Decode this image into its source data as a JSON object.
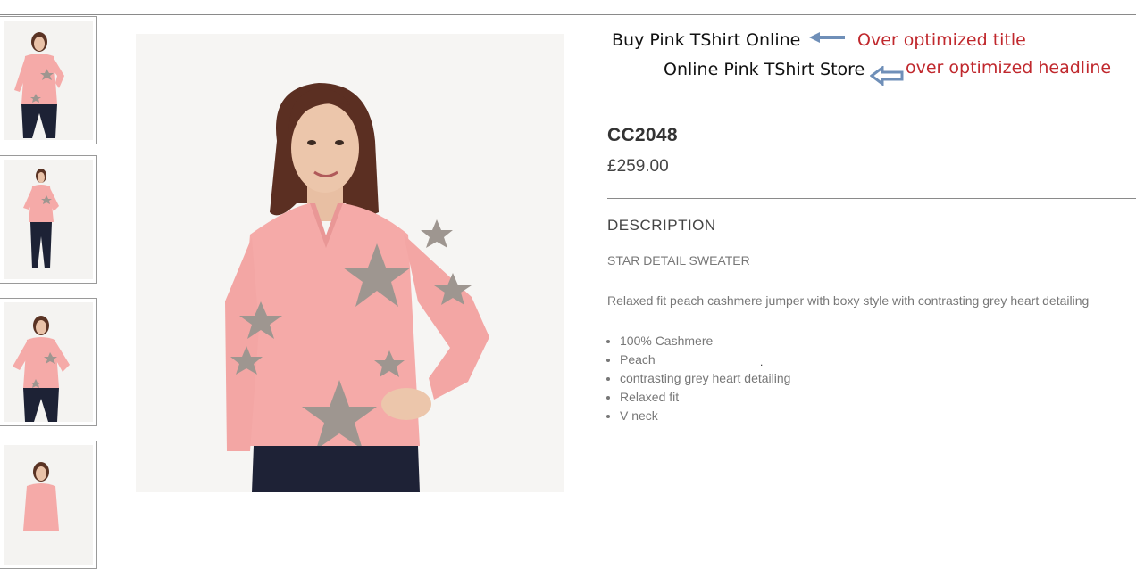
{
  "annotations": {
    "title_text": "Buy Pink TShirt Online",
    "title_note": "Over optimized title",
    "headline_text": "Online Pink TShirt Store",
    "headline_note": "over optimized headline"
  },
  "product": {
    "sku": "CC2048",
    "price": "£259.00",
    "description_heading": "DESCRIPTION",
    "subtitle": "STAR DETAIL SWEATER",
    "body": "Relaxed fit peach cashmere jumper with boxy style with contrasting grey heart detailing",
    "features": [
      "100% Cashmere",
      "Peach",
      "contrasting grey heart detailing",
      "Relaxed fit",
      "V neck"
    ],
    "stray_mark": "."
  },
  "colors": {
    "sweater": "#f5aaa8",
    "star": "#9e9690",
    "annotation_red": "#c0282d",
    "arrow_blue": "#6f8fb8"
  }
}
